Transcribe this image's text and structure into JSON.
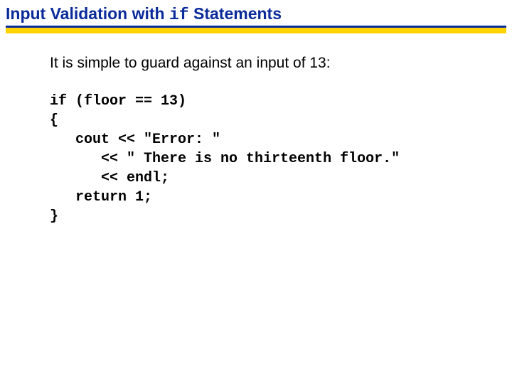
{
  "title": {
    "part1": "Input Validation with ",
    "code": "if",
    "part2": " Statements"
  },
  "intro": "It is simple to guard against an input of 13:",
  "code": {
    "l1": "if (floor == 13)",
    "l2": "{",
    "l3": "   cout << \"Error: \"",
    "l4": "      << \" There is no thirteenth floor.\"",
    "l5": "      << endl;",
    "l6": "   return 1;",
    "l7": "}"
  }
}
